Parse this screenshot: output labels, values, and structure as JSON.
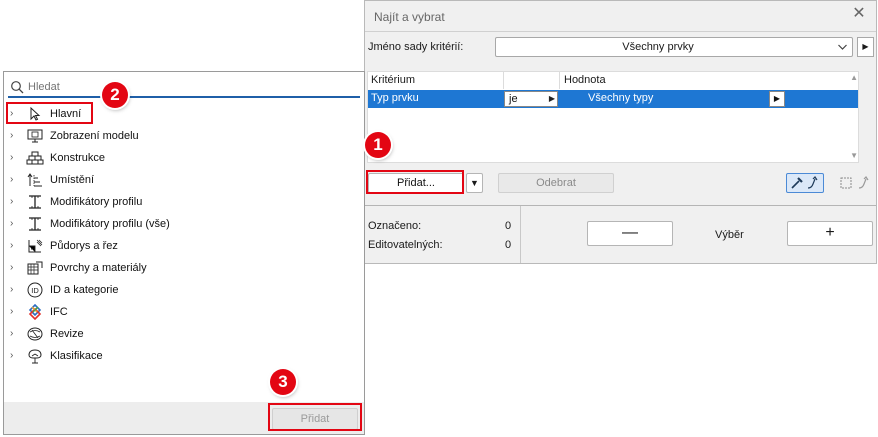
{
  "find_select": {
    "title": "Najít a vybrat",
    "criteria_set_label": "Jméno sady kritérií:",
    "criteria_set_value": "Všechny prvky",
    "table": {
      "headers": [
        "Kritérium",
        "Hodnota"
      ],
      "rows": [
        {
          "criterion": "Typ prvku",
          "operator": "je",
          "value": "Všechny typy"
        }
      ]
    },
    "add_label": "Přidat...",
    "remove_label": "Odebrat",
    "selected_label": "Označeno:",
    "selected_value": "0",
    "editable_label": "Editovatelných:",
    "editable_value": "0",
    "selection_label": "Výběr",
    "minus_label": "—",
    "plus_label": "+"
  },
  "add_popup": {
    "search_placeholder": "Hledat",
    "items": [
      {
        "label": "Hlavní",
        "icon": "cursor-arrow-icon"
      },
      {
        "label": "Zobrazení modelu",
        "icon": "monitor-icon"
      },
      {
        "label": "Konstrukce",
        "icon": "brick-wall-icon"
      },
      {
        "label": "Umístění",
        "icon": "elevation-arrow-icon"
      },
      {
        "label": "Modifikátory profilu",
        "icon": "i-beam-icon"
      },
      {
        "label": "Modifikátory profilu (vše)",
        "icon": "i-beam-icon"
      },
      {
        "label": "Půdorys a řez",
        "icon": "floor-plan-icon"
      },
      {
        "label": "Povrchy a materiály",
        "icon": "surface-material-icon"
      },
      {
        "label": "ID a kategorie",
        "icon": "id-circle-icon"
      },
      {
        "label": "IFC",
        "icon": "ifc-logo-icon"
      },
      {
        "label": "Revize",
        "icon": "revision-icon"
      },
      {
        "label": "Klasifikace",
        "icon": "classification-tree-icon"
      }
    ],
    "add_button_label": "Přidat"
  },
  "callouts": [
    "1",
    "2",
    "3"
  ],
  "colors": {
    "selection_blue": "#1e77d3",
    "callout_red": "#e30613",
    "search_underline": "#1f5fa8"
  }
}
